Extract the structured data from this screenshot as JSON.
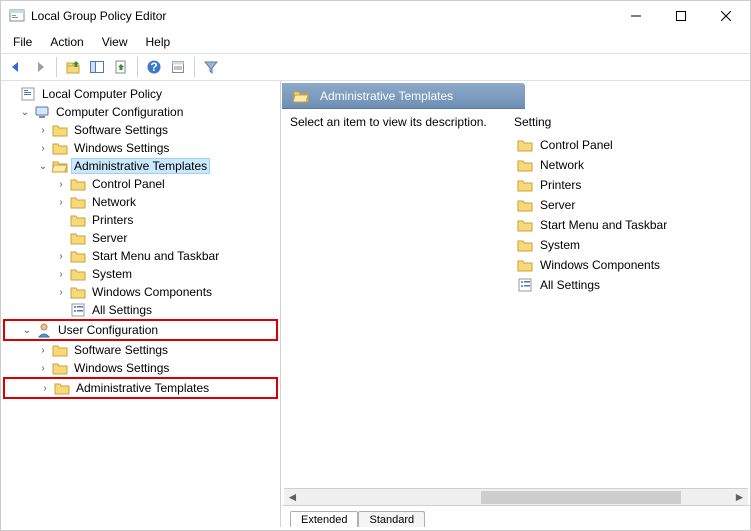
{
  "window": {
    "title": "Local Group Policy Editor"
  },
  "menu": {
    "file": "File",
    "action": "Action",
    "view": "View",
    "help": "Help"
  },
  "tree": {
    "root": "Local Computer Policy",
    "compConfig": "Computer Configuration",
    "cc_software": "Software Settings",
    "cc_windows": "Windows Settings",
    "cc_admin": "Administrative Templates",
    "cc_at_cp": "Control Panel",
    "cc_at_net": "Network",
    "cc_at_prn": "Printers",
    "cc_at_srv": "Server",
    "cc_at_smtb": "Start Menu and Taskbar",
    "cc_at_sys": "System",
    "cc_at_wc": "Windows Components",
    "cc_at_all": "All Settings",
    "userConfig": "User Configuration",
    "uc_software": "Software Settings",
    "uc_windows": "Windows Settings",
    "uc_admin": "Administrative Templates"
  },
  "right": {
    "header": "Administrative Templates",
    "desc": "Select an item to view its description.",
    "col": "Setting",
    "items": {
      "cp": "Control Panel",
      "net": "Network",
      "prn": "Printers",
      "srv": "Server",
      "smtb": "Start Menu and Taskbar",
      "sys": "System",
      "wc": "Windows Components",
      "all": "All Settings"
    }
  },
  "tabs": {
    "extended": "Extended",
    "standard": "Standard"
  }
}
